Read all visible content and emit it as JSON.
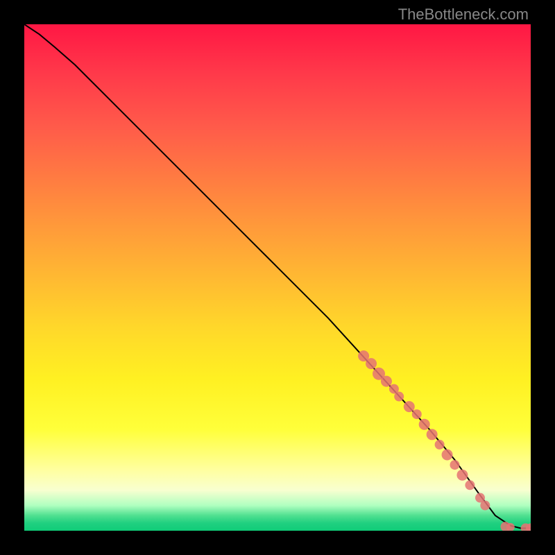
{
  "watermark": "TheBottleneck.com",
  "chart_data": {
    "type": "line",
    "title": "",
    "xlabel": "",
    "ylabel": "",
    "xlim": [
      0,
      100
    ],
    "ylim": [
      0,
      100
    ],
    "grid": false,
    "series": [
      {
        "name": "curve",
        "x": [
          0,
          3,
          6,
          10,
          20,
          30,
          40,
          50,
          60,
          70,
          80,
          85,
          90,
          93,
          96,
          98,
          100
        ],
        "y": [
          100,
          98,
          95.5,
          92,
          82,
          72,
          62,
          52,
          42,
          31,
          20,
          14,
          7,
          3,
          1,
          0.5,
          0.5
        ]
      }
    ],
    "scatter_points": {
      "name": "markers",
      "points": [
        {
          "x": 67,
          "y": 34.5,
          "r": 8
        },
        {
          "x": 68.5,
          "y": 33,
          "r": 8
        },
        {
          "x": 70,
          "y": 31,
          "r": 9
        },
        {
          "x": 71.5,
          "y": 29.5,
          "r": 8
        },
        {
          "x": 73,
          "y": 28,
          "r": 7
        },
        {
          "x": 74,
          "y": 26.5,
          "r": 7
        },
        {
          "x": 76,
          "y": 24.5,
          "r": 8
        },
        {
          "x": 77.5,
          "y": 23,
          "r": 7
        },
        {
          "x": 79,
          "y": 21,
          "r": 8
        },
        {
          "x": 80.5,
          "y": 19,
          "r": 8
        },
        {
          "x": 82,
          "y": 17,
          "r": 7
        },
        {
          "x": 83.5,
          "y": 15,
          "r": 8
        },
        {
          "x": 85,
          "y": 13,
          "r": 7
        },
        {
          "x": 86.5,
          "y": 11,
          "r": 8
        },
        {
          "x": 88,
          "y": 9,
          "r": 7
        },
        {
          "x": 90,
          "y": 6.5,
          "r": 7
        },
        {
          "x": 91,
          "y": 5,
          "r": 7
        },
        {
          "x": 95,
          "y": 0.8,
          "r": 7
        },
        {
          "x": 96,
          "y": 0.7,
          "r": 6
        },
        {
          "x": 99,
          "y": 0.5,
          "r": 7
        },
        {
          "x": 100,
          "y": 0.5,
          "r": 7
        }
      ]
    },
    "colors": {
      "curve": "#000000",
      "markers": "#e57373"
    }
  }
}
